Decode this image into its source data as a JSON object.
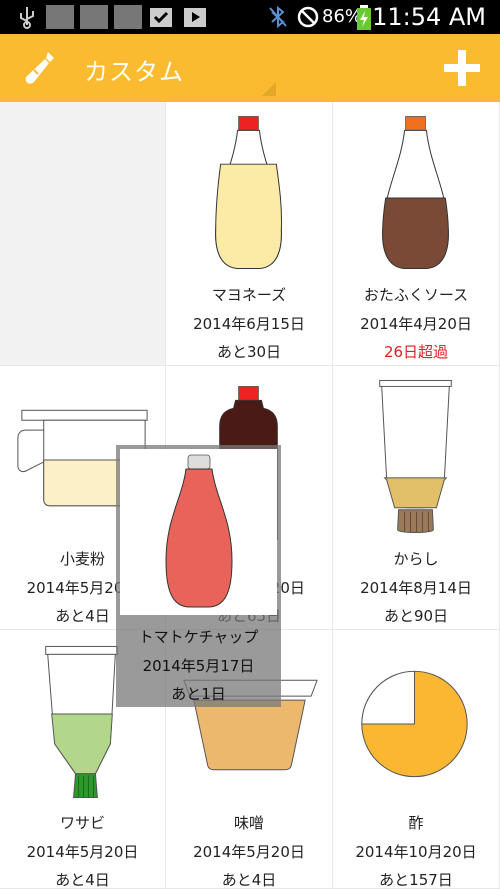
{
  "status_bar": {
    "battery": "86%",
    "time": "11:54 AM"
  },
  "app_bar": {
    "title": "カスタム",
    "accent_color": "#FBBB30"
  },
  "items": [
    {
      "name": "マヨネーズ",
      "date": "2014年6月15日",
      "remaining": "あと30日",
      "overdue": false,
      "icon": "mayonnaise-bottle"
    },
    {
      "name": "おたふくソース",
      "date": "2014年4月20日",
      "remaining": "26日超過",
      "overdue": true,
      "icon": "sauce-bottle"
    },
    {
      "name": "小麦粉",
      "date": "2014年5月20日",
      "remaining": "あと4日",
      "overdue": false,
      "icon": "flour-container"
    },
    {
      "name": "",
      "date": "2014年7月20日",
      "remaining": "あと65日",
      "overdue": false,
      "icon": "soy-sauce-bottle"
    },
    {
      "name": "からし",
      "date": "2014年8月14日",
      "remaining": "あと90日",
      "overdue": false,
      "icon": "mustard-tube"
    },
    {
      "name": "ワサビ",
      "date": "2014年5月20日",
      "remaining": "あと4日",
      "overdue": false,
      "icon": "wasabi-tube"
    },
    {
      "name": "味噌",
      "date": "2014年5月20日",
      "remaining": "あと4日",
      "overdue": false,
      "icon": "miso-container"
    },
    {
      "name": "酢",
      "date": "2014年10月20日",
      "remaining": "あと157日",
      "overdue": false,
      "icon": "vinegar-pie"
    }
  ],
  "dragging_item": {
    "name": "トマトケチャップ",
    "date": "2014年5月17日",
    "remaining": "あと1日",
    "icon": "ketchup-bottle"
  },
  "colors": {
    "overdue": "#E02020",
    "mayonnaise": "#FCEBA6",
    "sauce": "#7A4A36",
    "ketchup": "#E8645A",
    "vinegar": "#FBB731"
  }
}
